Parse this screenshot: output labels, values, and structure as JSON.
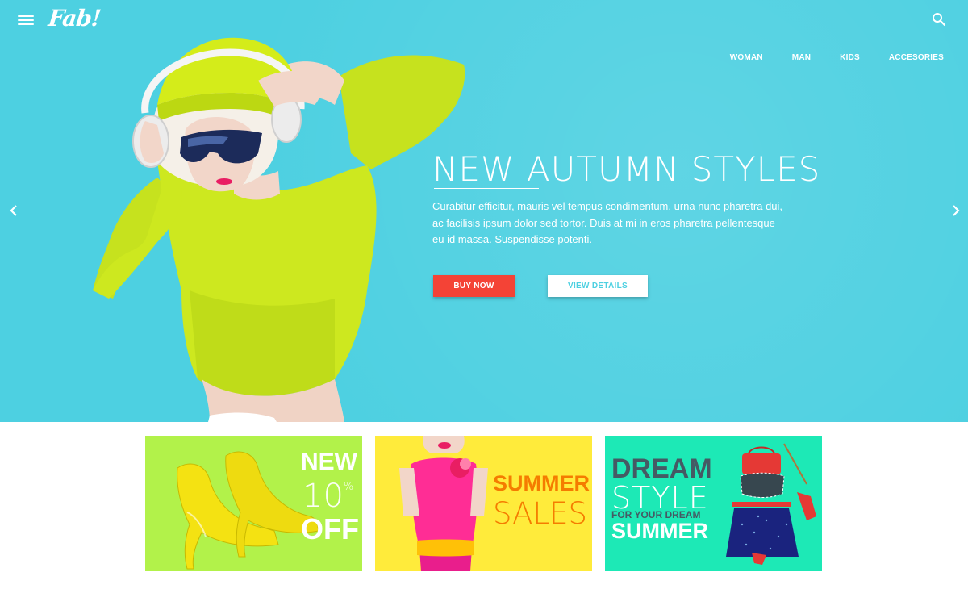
{
  "header": {
    "logo": "Fab!",
    "nav": [
      "WOMAN",
      "MAN",
      "KIDS",
      "ACCESORIES"
    ]
  },
  "hero": {
    "title": "NEW AUTUMN STYLES",
    "description": "Curabitur efficitur, mauris vel tempus condimentum, urna nunc pharetra dui, ac facilisis ipsum dolor sed tortor. Duis at mi in eros pharetra pellentesque eu id massa. Suspendisse potenti.",
    "buy_label": "BUY NOW",
    "view_label": "VIEW DETAILS"
  },
  "promos": {
    "p1": {
      "line1": "NEW",
      "percent": "10",
      "percent_sign": "%",
      "line3": "OFF"
    },
    "p2": {
      "line1": "SUMMER",
      "line2": "SALES"
    },
    "p3": {
      "line1": "DREAM",
      "line2": "STYLE",
      "line3_a": "FOR YOUR",
      "line3_b": "DREAM",
      "line4": "SUMMER"
    }
  },
  "colors": {
    "hero_bg": "#4dd0e1",
    "buy_button": "#f44336",
    "promo1_bg": "#b2f24a",
    "promo2_bg": "#ffeb3b",
    "promo3_bg": "#1de9b6"
  },
  "icons": [
    "menu-icon",
    "search-icon",
    "chevron-left-icon",
    "chevron-right-icon"
  ]
}
